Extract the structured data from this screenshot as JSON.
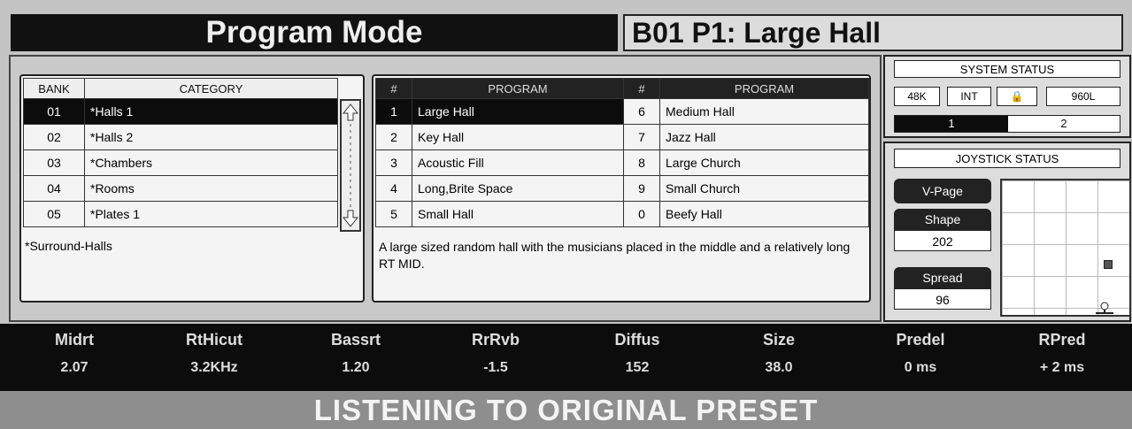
{
  "header": {
    "mode_title": "Program Mode",
    "program_title": "B01 P1: Large Hall"
  },
  "bank_table": {
    "headers": [
      "BANK",
      "CATEGORY"
    ],
    "rows": [
      {
        "bank": "01",
        "category": "*Halls 1"
      },
      {
        "bank": "02",
        "category": "*Halls 2"
      },
      {
        "bank": "03",
        "category": "*Chambers"
      },
      {
        "bank": "04",
        "category": "*Rooms"
      },
      {
        "bank": "05",
        "category": "*Plates 1"
      }
    ],
    "selected_index": 0,
    "note": "*Surround-Halls"
  },
  "program_table": {
    "headers": [
      "#",
      "PROGRAM",
      "#",
      "PROGRAM"
    ],
    "rows": [
      {
        "n1": "1",
        "p1": "Large Hall",
        "n2": "6",
        "p2": "Medium Hall"
      },
      {
        "n1": "2",
        "p1": "Key Hall",
        "n2": "7",
        "p2": "Jazz Hall"
      },
      {
        "n1": "3",
        "p1": "Acoustic Fill",
        "n2": "8",
        "p2": "Large Church"
      },
      {
        "n1": "4",
        "p1": "Long,Brite Space",
        "n2": "9",
        "p2": "Small Church"
      },
      {
        "n1": "5",
        "p1": "Small Hall",
        "n2": "0",
        "p2": "Beefy Hall"
      }
    ],
    "description": "A large sized random hall with the musicians placed in the middle and a relatively long RT MID."
  },
  "system_status": {
    "title": "SYSTEM STATUS",
    "buttons": [
      "48K",
      "INT",
      "🔒",
      "960L"
    ],
    "selector": [
      "1",
      "2"
    ],
    "active_selector": "1"
  },
  "joystick_status": {
    "title": "JOYSTICK STATUS",
    "vpage_label": "V-Page",
    "shape_label": "Shape",
    "shape_value": "202",
    "spread_label": "Spread",
    "spread_value": "96"
  },
  "params": [
    {
      "name": "Midrt",
      "value": "2.07"
    },
    {
      "name": "RtHicut",
      "value": "3.2KHz"
    },
    {
      "name": "Bassrt",
      "value": "1.20"
    },
    {
      "name": "RrRvb",
      "value": "-1.5"
    },
    {
      "name": "Diffus",
      "value": "152"
    },
    {
      "name": "Size",
      "value": "38.0"
    },
    {
      "name": "Predel",
      "value": "0 ms"
    },
    {
      "name": "RPred",
      "value": "+ 2 ms"
    }
  ],
  "status_message": "LISTENING TO ORIGINAL PRESET"
}
